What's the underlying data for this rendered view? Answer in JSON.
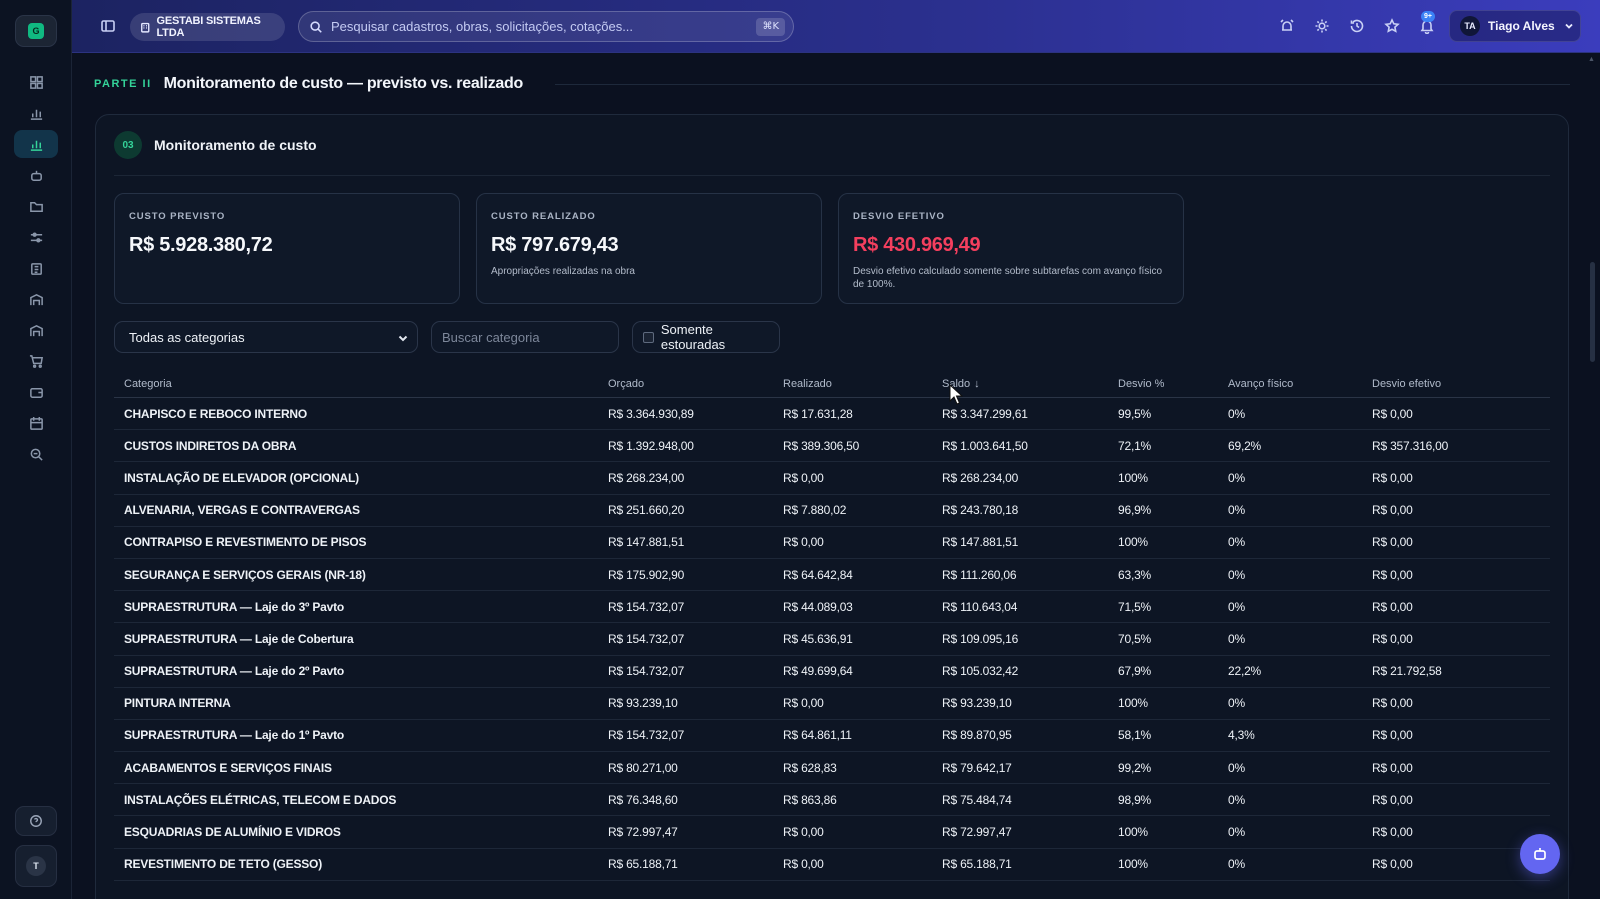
{
  "sidebar": {
    "logo_letter": "G",
    "items": [
      {
        "icon": "dashboard-icon",
        "active": false
      },
      {
        "icon": "bar-chart-icon",
        "active": false
      },
      {
        "icon": "bar-chart-icon",
        "active": true
      },
      {
        "icon": "robot-icon",
        "active": false
      },
      {
        "icon": "folder-icon",
        "active": false
      },
      {
        "icon": "sliders-icon",
        "active": false
      },
      {
        "icon": "clipboard-icon",
        "active": false
      },
      {
        "icon": "warehouse-icon",
        "active": false
      },
      {
        "icon": "warehouse-icon",
        "active": false
      },
      {
        "icon": "cart-icon",
        "active": false
      },
      {
        "icon": "wallet-icon",
        "active": false
      },
      {
        "icon": "calendar-icon",
        "active": false
      },
      {
        "icon": "search-zoom-icon",
        "active": false
      }
    ],
    "help_icon": "help-circle-icon",
    "user_initial": "T"
  },
  "topbar": {
    "company": "GESTABI SISTEMAS LTDA",
    "search_placeholder": "Pesquisar cadastros, obras, solicitações, cotações...",
    "search_shortcut": "⌘K",
    "notification_badge": "9+",
    "user_initials": "TA",
    "user_name": "Tiago Alves"
  },
  "section": {
    "part_tag": "PARTE II",
    "part_title": "Monitoramento de custo — previsto vs. realizado",
    "number": "03",
    "title": "Monitoramento de custo"
  },
  "cards": [
    {
      "label": "CUSTO PREVISTO",
      "value": "R$ 5.928.380,72",
      "note": ""
    },
    {
      "label": "CUSTO REALIZADO",
      "value": "R$ 797.679,43",
      "note": "Apropriações realizadas na obra"
    },
    {
      "label": "DESVIO EFETIVO",
      "value": "R$ 430.969,49",
      "note": "Desvio efetivo calculado somente sobre subtarefas com avanço físico de 100%."
    }
  ],
  "filters": {
    "category_select": "Todas as categorias",
    "search_placeholder": "Buscar categoria",
    "only_overrun_label": "Somente estouradas"
  },
  "table": {
    "headers": [
      "Categoria",
      "Orçado",
      "Realizado",
      "Saldo",
      "Desvio %",
      "Avanço físico",
      "Desvio efetivo"
    ],
    "sort_indicator": "↓",
    "rows": [
      [
        "CHAPISCO E REBOCO INTERNO",
        "R$ 3.364.930,89",
        "R$ 17.631,28",
        "R$ 3.347.299,61",
        "99,5%",
        "0%",
        "R$ 0,00"
      ],
      [
        "CUSTOS INDIRETOS DA OBRA",
        "R$ 1.392.948,00",
        "R$ 389.306,50",
        "R$ 1.003.641,50",
        "72,1%",
        "69,2%",
        "R$ 357.316,00"
      ],
      [
        "INSTALAÇÃO DE ELEVADOR (OPCIONAL)",
        "R$ 268.234,00",
        "R$ 0,00",
        "R$ 268.234,00",
        "100%",
        "0%",
        "R$ 0,00"
      ],
      [
        "ALVENARIA, VERGAS E CONTRAVERGAS",
        "R$ 251.660,20",
        "R$ 7.880,02",
        "R$ 243.780,18",
        "96,9%",
        "0%",
        "R$ 0,00"
      ],
      [
        "CONTRAPISO E REVESTIMENTO DE PISOS",
        "R$ 147.881,51",
        "R$ 0,00",
        "R$ 147.881,51",
        "100%",
        "0%",
        "R$ 0,00"
      ],
      [
        "SEGURANÇA E SERVIÇOS GERAIS (NR-18)",
        "R$ 175.902,90",
        "R$ 64.642,84",
        "R$ 111.260,06",
        "63,3%",
        "0%",
        "R$ 0,00"
      ],
      [
        "SUPRAESTRUTURA — Laje do 3º Pavto",
        "R$ 154.732,07",
        "R$ 44.089,03",
        "R$ 110.643,04",
        "71,5%",
        "0%",
        "R$ 0,00"
      ],
      [
        "SUPRAESTRUTURA — Laje de Cobertura",
        "R$ 154.732,07",
        "R$ 45.636,91",
        "R$ 109.095,16",
        "70,5%",
        "0%",
        "R$ 0,00"
      ],
      [
        "SUPRAESTRUTURA — Laje do 2º Pavto",
        "R$ 154.732,07",
        "R$ 49.699,64",
        "R$ 105.032,42",
        "67,9%",
        "22,2%",
        "R$ 21.792,58"
      ],
      [
        "PINTURA INTERNA",
        "R$ 93.239,10",
        "R$ 0,00",
        "R$ 93.239,10",
        "100%",
        "0%",
        "R$ 0,00"
      ],
      [
        "SUPRAESTRUTURA — Laje do 1º Pavto",
        "R$ 154.732,07",
        "R$ 64.861,11",
        "R$ 89.870,95",
        "58,1%",
        "4,3%",
        "R$ 0,00"
      ],
      [
        "ACABAMENTOS E SERVIÇOS FINAIS",
        "R$ 80.271,00",
        "R$ 628,83",
        "R$ 79.642,17",
        "99,2%",
        "0%",
        "R$ 0,00"
      ],
      [
        "INSTALAÇÕES ELÉTRICAS, TELECOM E DADOS",
        "R$ 76.348,60",
        "R$ 863,86",
        "R$ 75.484,74",
        "98,9%",
        "0%",
        "R$ 0,00"
      ],
      [
        "ESQUADRIAS DE ALUMÍNIO E VIDROS",
        "R$ 72.997,47",
        "R$ 0,00",
        "R$ 72.997,47",
        "100%",
        "0%",
        "R$ 0,00"
      ],
      [
        "REVESTIMENTO DE TETO (GESSO)",
        "R$ 65.188,71",
        "R$ 0,00",
        "R$ 65.188,71",
        "100%",
        "0%",
        "R$ 0,00"
      ]
    ]
  },
  "colors": {
    "accent_green": "#34d399",
    "negative_red": "#f43f5e",
    "topbar_start": "#1c2361",
    "topbar_end": "#3b3dbd",
    "fab": "#6366f1"
  }
}
